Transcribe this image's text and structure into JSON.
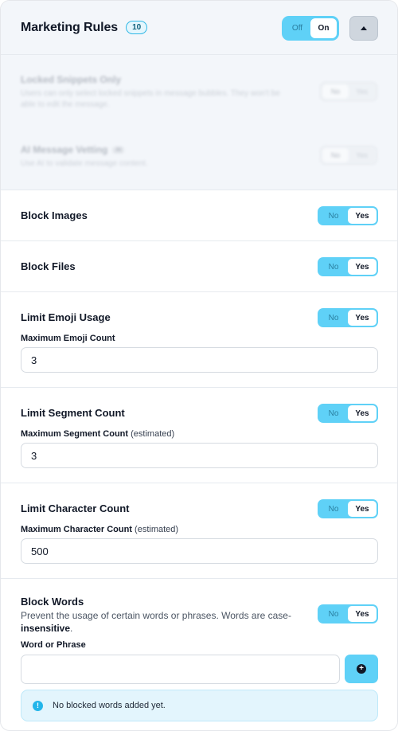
{
  "header": {
    "title": "Marketing Rules",
    "count": "10",
    "toggle": {
      "off_label": "Off",
      "on_label": "On",
      "selected": "On"
    },
    "collapse_icon": "caret-up-icon"
  },
  "disabled_rules": [
    {
      "title": "Locked Snippets Only",
      "description": "Users can only select locked snippets in message bubbles. They won't be able to edit the message.",
      "toggle": {
        "no_label": "No",
        "yes_label": "Yes",
        "selected": "No"
      }
    },
    {
      "title": "AI Message Vetting",
      "badge": "AI",
      "description": "Use AI to validate message content.",
      "toggle": {
        "no_label": "No",
        "yes_label": "Yes",
        "selected": "No"
      }
    }
  ],
  "rules": {
    "block_images": {
      "title": "Block Images",
      "toggle": {
        "no_label": "No",
        "yes_label": "Yes",
        "selected": "Yes"
      }
    },
    "block_files": {
      "title": "Block Files",
      "toggle": {
        "no_label": "No",
        "yes_label": "Yes",
        "selected": "Yes"
      }
    },
    "limit_emoji": {
      "title": "Limit Emoji Usage",
      "toggle": {
        "no_label": "No",
        "yes_label": "Yes",
        "selected": "Yes"
      },
      "field_label": "Maximum Emoji Count",
      "value": "3"
    },
    "limit_segment": {
      "title": "Limit Segment Count",
      "toggle": {
        "no_label": "No",
        "yes_label": "Yes",
        "selected": "Yes"
      },
      "field_label": "Maximum Segment Count",
      "field_hint": "(estimated)",
      "value": "3"
    },
    "limit_character": {
      "title": "Limit Character Count",
      "toggle": {
        "no_label": "No",
        "yes_label": "Yes",
        "selected": "Yes"
      },
      "field_label": "Maximum Character Count",
      "field_hint": "(estimated)",
      "value": "500"
    },
    "block_words": {
      "title": "Block Words",
      "description_prefix": "Prevent the usage of certain words or phrases. Words are case-",
      "description_bold": "insensitive",
      "description_suffix": ".",
      "toggle": {
        "no_label": "No",
        "yes_label": "Yes",
        "selected": "Yes"
      },
      "field_label": "Word or Phrase",
      "value": "",
      "add_icon": "plus-circle-icon",
      "empty_message": "No blocked words added yet.",
      "info_icon": "info-icon"
    }
  },
  "colors": {
    "accent": "#5fd1f7",
    "badge_border": "#31b8e6",
    "info_bg": "#e3f5fd"
  }
}
